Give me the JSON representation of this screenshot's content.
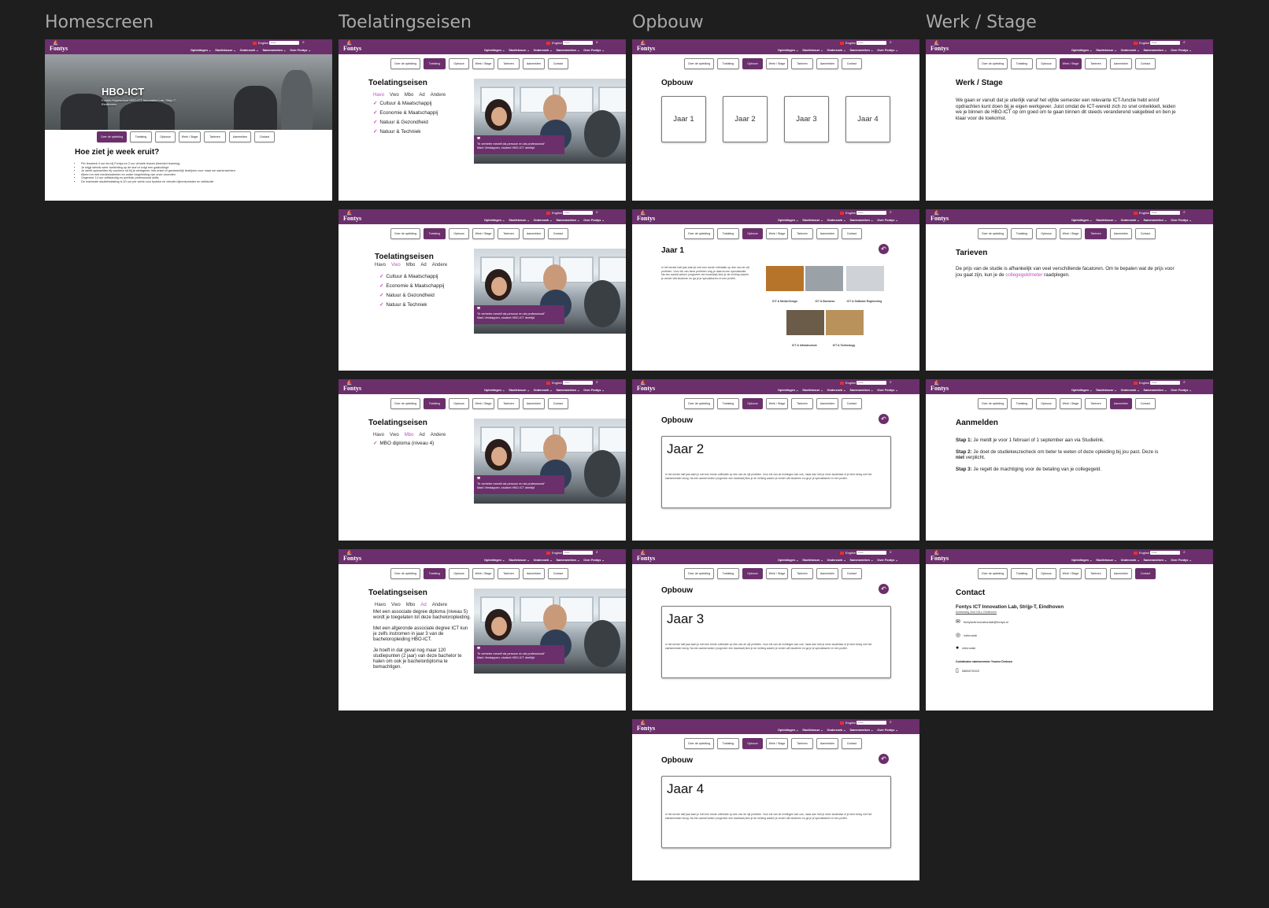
{
  "columns": [
    "Homescreen",
    "Toelatingseisen",
    "Opbouw",
    "Werk / Stage"
  ],
  "header": {
    "logo": "Fontys",
    "language": "English",
    "search_placeholder": "Zoek",
    "nav": [
      "Opleidingen ⌄",
      "Studiekeuze ⌄",
      "Onderzoek ⌄",
      "Samenwerken ⌄",
      "Over Fontys ⌄"
    ]
  },
  "tabs": [
    "Over de opleiding",
    "Toelating",
    "Opbouw",
    "Werk / Stage",
    "Tarieven",
    "Aanmelden",
    "Contact"
  ],
  "home": {
    "hero_title": "HBO-ICT",
    "hero_sub": "Fontys Hogeschool HBO-ICT Innovation Lab, Strijp-T, Eindhoven",
    "heading": "Hoe ziet je week eruit?",
    "items": [
      "Per lesweek 4 uur les bij Fontys en 2 uur virtuele lessen (blended learning)",
      "Je krijgt steeds weer toelichting op de stof of volgt een gastcollege",
      "Je werkt opdrachten bij voorkeur uit bij je werkgever, iets enkel of gezamenlijk bedrijven voor maar we samenwerken",
      "Alleen en met medestudenten en onder begeleiding van onze docenten",
      "Ongeveer 14 uur zelfstandig en portfolio professional skills",
      "De maximale studiebelasting is 20 uur per week voor fysieke en virtuele bijeenkomsten en zelfstudie"
    ]
  },
  "toel": {
    "title": "Toelatingseisen",
    "levels": [
      "Havo",
      "Vwo",
      "Mbo",
      "Ad",
      "Andere"
    ],
    "profiles": [
      "Cultuur & Maatschappij",
      "Economie & Maatschappij",
      "Natuur & Gezondheid",
      "Natuur & Techniek"
    ],
    "mbo": "MBO diploma (niveau 4)",
    "ad_p1": "Met een associate degree diploma (niveau 5) wordt je toegelaten tot deze bacheloropleiding.",
    "ad_p2": "Met een afgeronde associate degree ICT kun je zelfs instromen in jaar 3 van de bacheloropleiding HBO-ICT.",
    "ad_p3": "Je hoeft in dat geval nog maar 120 studiepunten (2 jaar) van deze bachelor te halen om ook je bachelordiploma te bemachtigen.",
    "quote": "\"Ik verbeter mezelf als persoon en als professional\"",
    "quote_by": "Mark Verstappen, student HBO-ICT deeltijd"
  },
  "opbouw": {
    "title": "Opbouw",
    "years": [
      "Jaar 1",
      "Jaar 2",
      "Jaar 3",
      "Jaar 4"
    ],
    "jaar1_text": "In het eerste half jaar start je met een brede oriëntatie op drie van de vijf profielen. Voor elk van deze profielen volg je daarna een specialisatie. Na een aantal weken (ongeveer een kwartaal) kies je de richting waarin je verder wilt studeren en ga je je specialiseren in een profiel.",
    "profiles": [
      "ICT & Media Design",
      "ICT & Business",
      "ICT & Software Engineering",
      "ICT & Infrastructure",
      "ICT & Technology"
    ],
    "detail_text": "In het eerste half jaar start je met een brede oriëntatie op drie van de vijf profielen. Voor elk van de richtingen kan ook, maar dan heb je meer studielast of je bent bezig met het startsemester bezig. Na een aantal weken (ongeveer een kwartaal) kies je de richting waarin je verder wilt studeren en ga je je specialiseren in een profiel."
  },
  "werk": {
    "title": "Werk / Stage",
    "text": "We gaan er vanuit dat je uiterlijk vanaf het vijfde semester een relevante ICT-functie hebt en/of opdrachten kunt doen bij je eigen werkgever. Juist omdat de ICT-wereld zich zo snel ontwikkelt, leiden we je binnen de HBO-ICT op om goed om te gaan binnen dit steeds veranderend vakgebied en ben je klaar voor de toekomst."
  },
  "tarieven": {
    "title": "Tarieven",
    "text_a": "De prijs van de studie is afhankelijk van veel verschillende facatoren. Om te bepalen wat de prijs voor jou gaat zijn, kun je de",
    "link": "collegegeldmeter",
    "text_b": "raadplegen."
  },
  "aanmelden": {
    "title": "Aanmelden",
    "s1_label": "Stap 1:",
    "s1": "Je meldt je voor 1 februari of 1 september aan via Studielink.",
    "s2_label": "Stap 2:",
    "s2a": "Je doet de studiekeuzecheck om beter te weten of deze opleiding bij jou past. Deze is",
    "s2_bold": "niet",
    "s2b": "verplicht.",
    "s3_label": "Stap 3:",
    "s3": "Je regelt de machtiging voor de betaling van je collegegeld."
  },
  "contact": {
    "title": "Contact",
    "location": "Fontys ICT Innovation Lab, Strijp-T, Eindhoven",
    "address": "Achtseweg Zuid 151c, Eindhoven",
    "email": "fontysictinnovationlab@fontys.nl",
    "instagram": "ictinnolab",
    "linkedin": "ictinnolab",
    "coordinator": "Coördinator startsemester Yvonne Derksen",
    "phone": "0885076320"
  },
  "colors": {
    "purple": "#6b2f6b",
    "accent_pink": "#c04ec0",
    "canvas": "#1e1e1e"
  }
}
